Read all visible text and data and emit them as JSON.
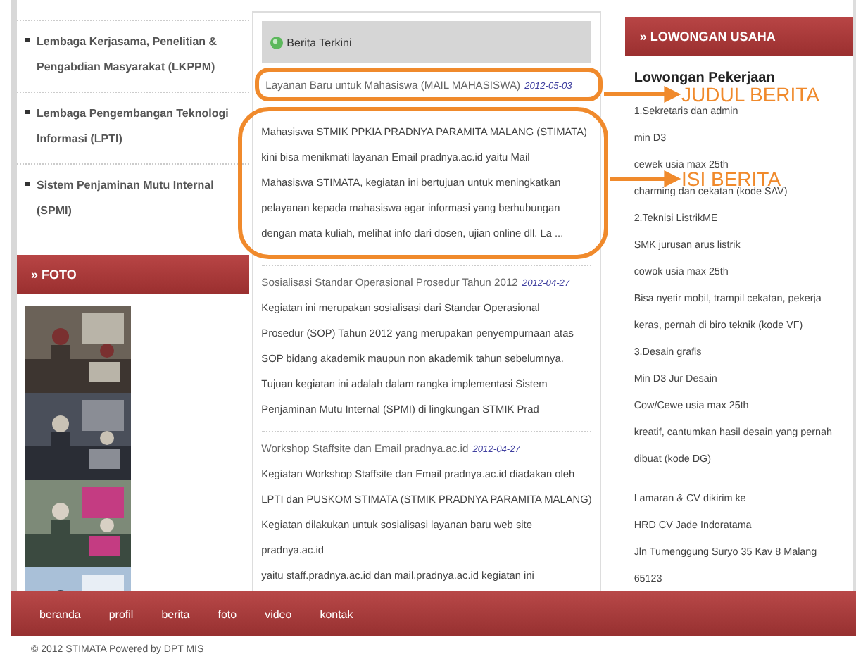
{
  "left_menu": {
    "items": [
      {
        "label": "Lembaga Kerjasama, Penelitian & Pengabdian Masyarakat (LKPPM)"
      },
      {
        "label": "Lembaga Pengembangan Teknologi Informasi (LPTI)"
      },
      {
        "label": "Sistem Penjaminan Mutu Internal (SPMI)"
      }
    ]
  },
  "photos": {
    "title": "» FOTO"
  },
  "news": {
    "title": "Berita Terkini",
    "items": [
      {
        "title": "Layanan Baru untuk Mahasiswa (MAIL MAHASISWA)",
        "date": "2012-05-03",
        "lines": [
          "Mahasiswa STMIK PPKIA PRADNYA PARAMITA MALANG (STIMATA)",
          "kini bisa menikmati layanan Email pradnya.ac.id yaitu Mail",
          "Mahasiswa STIMATA, kegiatan ini bertujuan untuk meningkatkan",
          "pelayanan kepada mahasiswa agar informasi yang berhubungan",
          "dengan mata kuliah, melihat info dari dosen, ujian online dll. La ..."
        ]
      },
      {
        "title": "Sosialisasi Standar Operasional Prosedur Tahun 2012",
        "date": "2012-04-27",
        "lines": [
          "Kegiatan ini merupakan sosialisasi dari Standar Operasional",
          "Prosedur (SOP) Tahun 2012 yang merupakan penyempurnaan atas",
          "SOP bidang akademik maupun non akademik tahun sebelumnya.",
          "Tujuan kegiatan ini adalah dalam rangka implementasi Sistem",
          "Penjaminan Mutu Internal (SPMI) di lingkungan STMIK Prad"
        ]
      },
      {
        "title": "Workshop Staffsite dan Email pradnya.ac.id",
        "date": "2012-04-27",
        "lines": [
          "Kegiatan Workshop Staffsite dan Email pradnya.ac.id diadakan oleh",
          "LPTI dan PUSKOM STIMATA (STMIK PRADNYA PARAMITA MALANG)",
          "Kegiatan dilakukan untuk sosialisasi layanan baru web site",
          "pradnya.ac.id",
          "yaitu staff.pradnya.ac.id dan mail.pradnya.ac.id kegiatan ini"
        ]
      }
    ]
  },
  "jobs": {
    "title": "» LOWONGAN USAHA",
    "heading": "Lowongan Pekerjaan",
    "paragraphs": [
      [
        "1.Sekretaris dan admin",
        "min D3",
        "cewek usia max 25th",
        "charming dan cekatan (kode SAV)",
        "2.Teknisi ListrikME",
        "SMK jurusan arus listrik",
        "cowok usia max 25th",
        "Bisa nyetir mobil, trampil cekatan, pekerja",
        "keras, pernah di biro teknik (kode VF)",
        "3.Desain grafis",
        "Min D3 Jur Desain",
        "Cow/Cewe usia max 25th",
        "kreatif, cantumkan hasil desain yang pernah",
        "dibuat (kode DG)"
      ],
      [
        "Lamaran & CV dikirim ke",
        "HRD CV Jade Indoratama",
        "Jln Tumenggung Suryo 35 Kav 8 Malang",
        "65123"
      ]
    ]
  },
  "nav": {
    "items": [
      {
        "label": "beranda"
      },
      {
        "label": "profil"
      },
      {
        "label": "berita"
      },
      {
        "label": "foto"
      },
      {
        "label": "video"
      },
      {
        "label": "kontak"
      }
    ]
  },
  "footer": {
    "text": "© 2012 STIMATA Powered by DPT MIS"
  },
  "annotations": [
    {
      "kind": "title",
      "label": "JUDUL BERITA"
    },
    {
      "kind": "body",
      "label": "ISI BERITA"
    }
  ]
}
